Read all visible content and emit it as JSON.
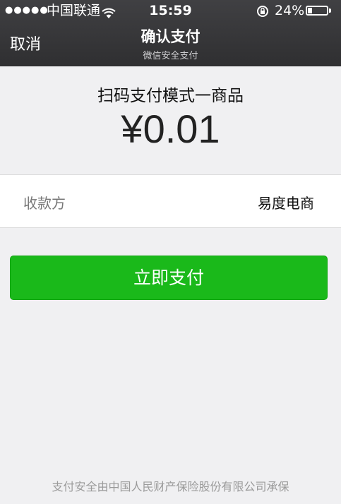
{
  "status_bar": {
    "signal": "●●●●●",
    "carrier": "中国联通",
    "time": "15:59",
    "battery_percent": "24%",
    "battery_level": 0.24,
    "icons": [
      "wifi-icon",
      "rotation-lock-icon",
      "battery-icon"
    ]
  },
  "nav": {
    "cancel_label": "取消",
    "title": "确认支付",
    "subtitle": "微信安全支付"
  },
  "order": {
    "product_name": "扫码支付模式一商品",
    "amount": "¥0.01"
  },
  "payee": {
    "label": "收款方",
    "value": "易度电商"
  },
  "pay_button_label": "立即支付",
  "footer_text": "支付安全由中国人民财产保险股份有限公司承保",
  "colors": {
    "header_bg": "#3a3a3c",
    "page_bg": "#f0f0f2",
    "button_green": "#1ab91a"
  }
}
